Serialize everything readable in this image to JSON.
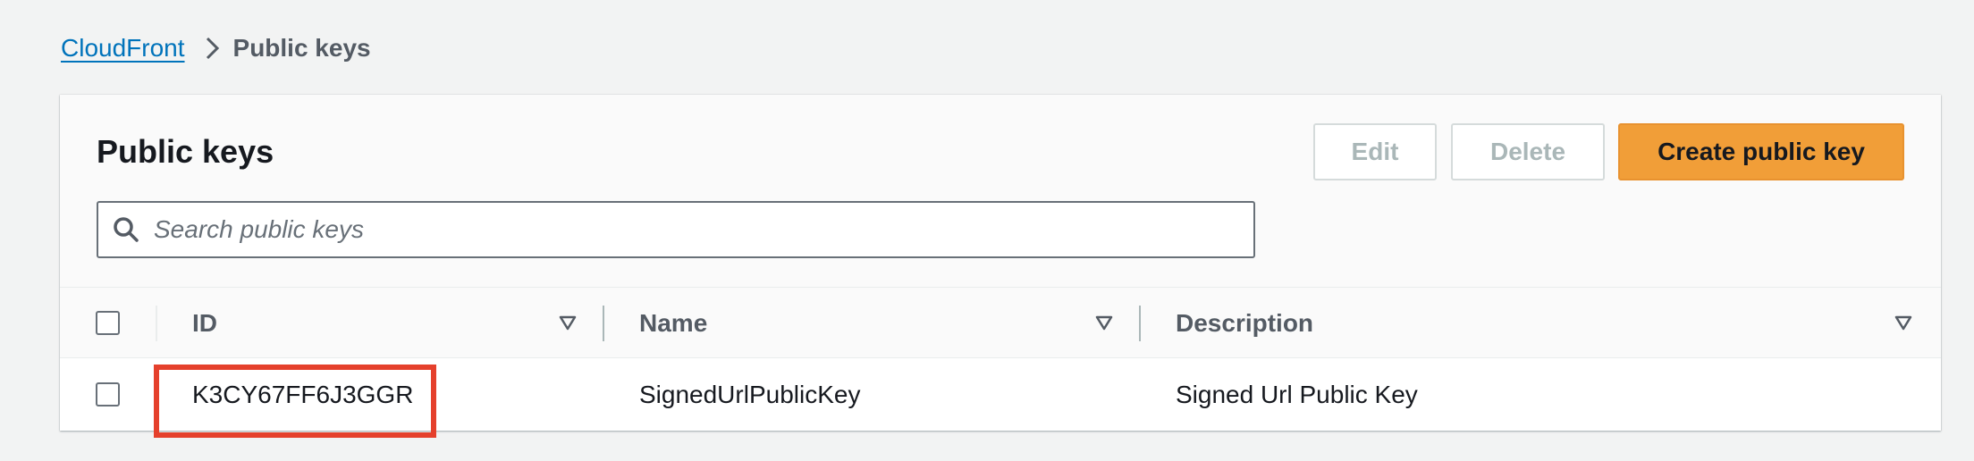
{
  "breadcrumb": {
    "parent": "CloudFront",
    "current": "Public keys"
  },
  "panel": {
    "title": "Public keys",
    "buttons": {
      "edit": "Edit",
      "delete": "Delete",
      "create": "Create public key"
    },
    "search": {
      "placeholder": "Search public keys",
      "value": ""
    }
  },
  "table": {
    "columns": [
      "ID",
      "Name",
      "Description"
    ],
    "rows": [
      {
        "id": "K3CY67FF6J3GGR",
        "name": "SignedUrlPublicKey",
        "description": "Signed Url Public Key"
      }
    ]
  },
  "colors": {
    "primary_button": "#f19e38",
    "link": "#0073bb",
    "highlight": "#e5402c"
  },
  "icons": [
    "chevron-right-icon",
    "search-icon",
    "sort-caret-icon"
  ]
}
